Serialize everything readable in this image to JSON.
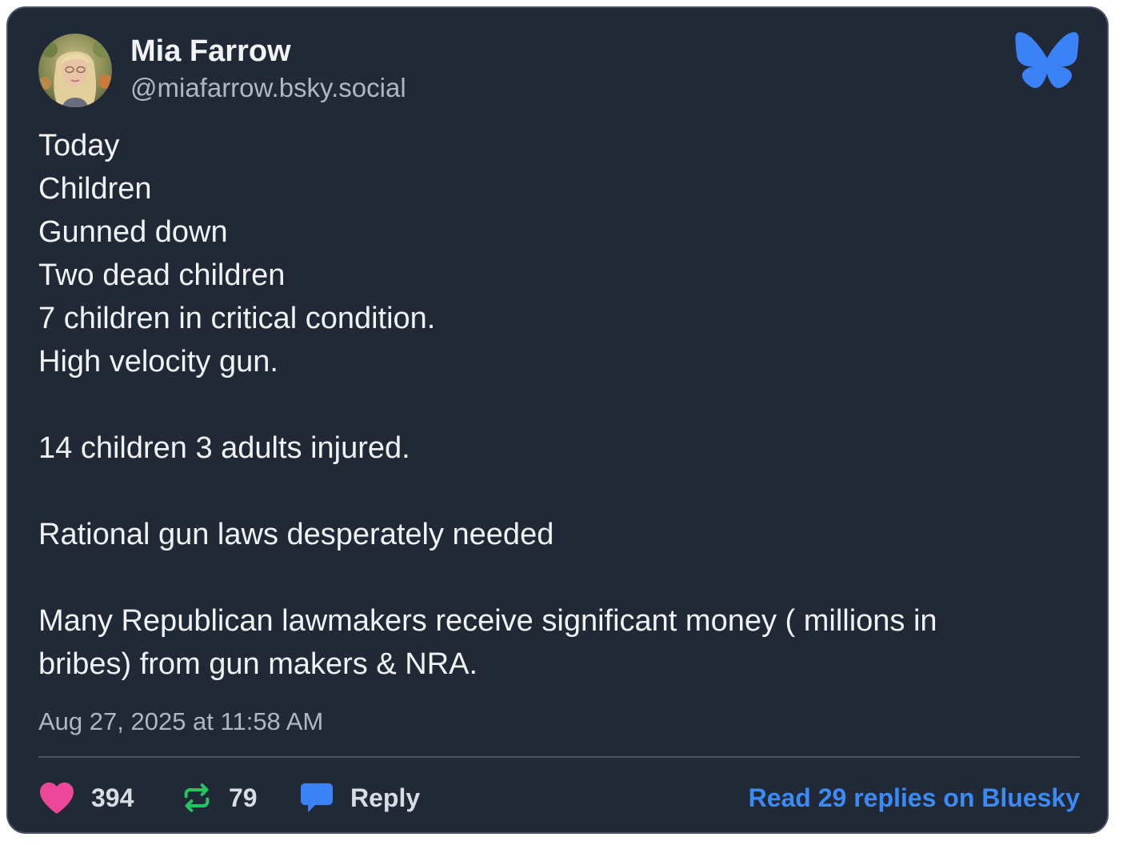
{
  "author": {
    "name": "Mia Farrow",
    "handle": "@miafarrow.bsky.social",
    "avatar": "profile-photo"
  },
  "logo": {
    "icon": "bluesky-butterfly-icon",
    "color": "#3b82f6"
  },
  "post": {
    "lines": [
      "Today",
      "Children",
      "Gunned down",
      "Two dead children",
      "7 children in critical condition.",
      "High velocity gun.",
      "",
      "14 children 3 adults injured.",
      "",
      "Rational gun laws desperately needed",
      "",
      "Many Republican lawmakers receive significant money ( millions in bribes) from gun makers & NRA."
    ],
    "timestamp": "Aug 27, 2025 at 11:58 AM"
  },
  "actions": {
    "likes": {
      "icon": "heart-icon",
      "count": "394",
      "color": "#ec4899"
    },
    "reposts": {
      "icon": "repost-icon",
      "count": "79",
      "color": "#22c55e"
    },
    "reply": {
      "icon": "speech-bubble-icon",
      "label": "Reply",
      "color": "#3b82f6"
    },
    "read_replies": "Read 29 replies on Bluesky"
  },
  "colors": {
    "card_background": "#212836",
    "card_border": "#4a5364",
    "text_primary": "#f1f3f5",
    "text_secondary": "#aeb7c4",
    "link": "#3b8bf7"
  }
}
